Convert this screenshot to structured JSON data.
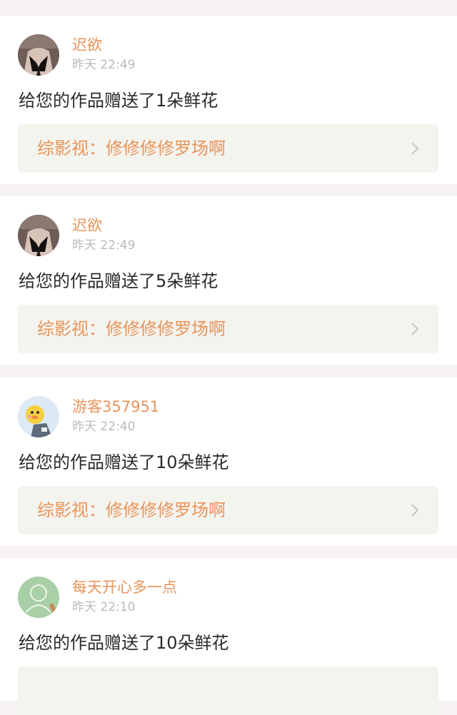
{
  "notifications": [
    {
      "avatar": "dark-portrait-avatar",
      "username": "迟欲",
      "time": "昨天 22:49",
      "message": "给您的作品赠送了1朵鲜花",
      "work": "综影视：修修修修罗场啊"
    },
    {
      "avatar": "dark-portrait-avatar",
      "username": "迟欲",
      "time": "昨天 22:49",
      "message": "给您的作品赠送了5朵鲜花",
      "work": "综影视：修修修修罗场啊"
    },
    {
      "avatar": "duck-guest-avatar",
      "username": "游客357951",
      "time": "昨天 22:40",
      "message": "给您的作品赠送了10朵鲜花",
      "work": "综影视：修修修修罗场啊"
    },
    {
      "avatar": "green-chalkboard-avatar",
      "username": "每天开心多一点",
      "time": "昨天 22:10",
      "message": "给您的作品赠送了10朵鲜花",
      "work": ""
    }
  ],
  "icons": {
    "chevron": "chevron-right-icon"
  },
  "colors": {
    "accent": "#e8945a",
    "page_background": "#f7f3f3",
    "card_background": "#ffffff",
    "link_background": "#f4f4ef",
    "time_text": "#b9b9b9",
    "body_text": "#2a2a2a"
  }
}
